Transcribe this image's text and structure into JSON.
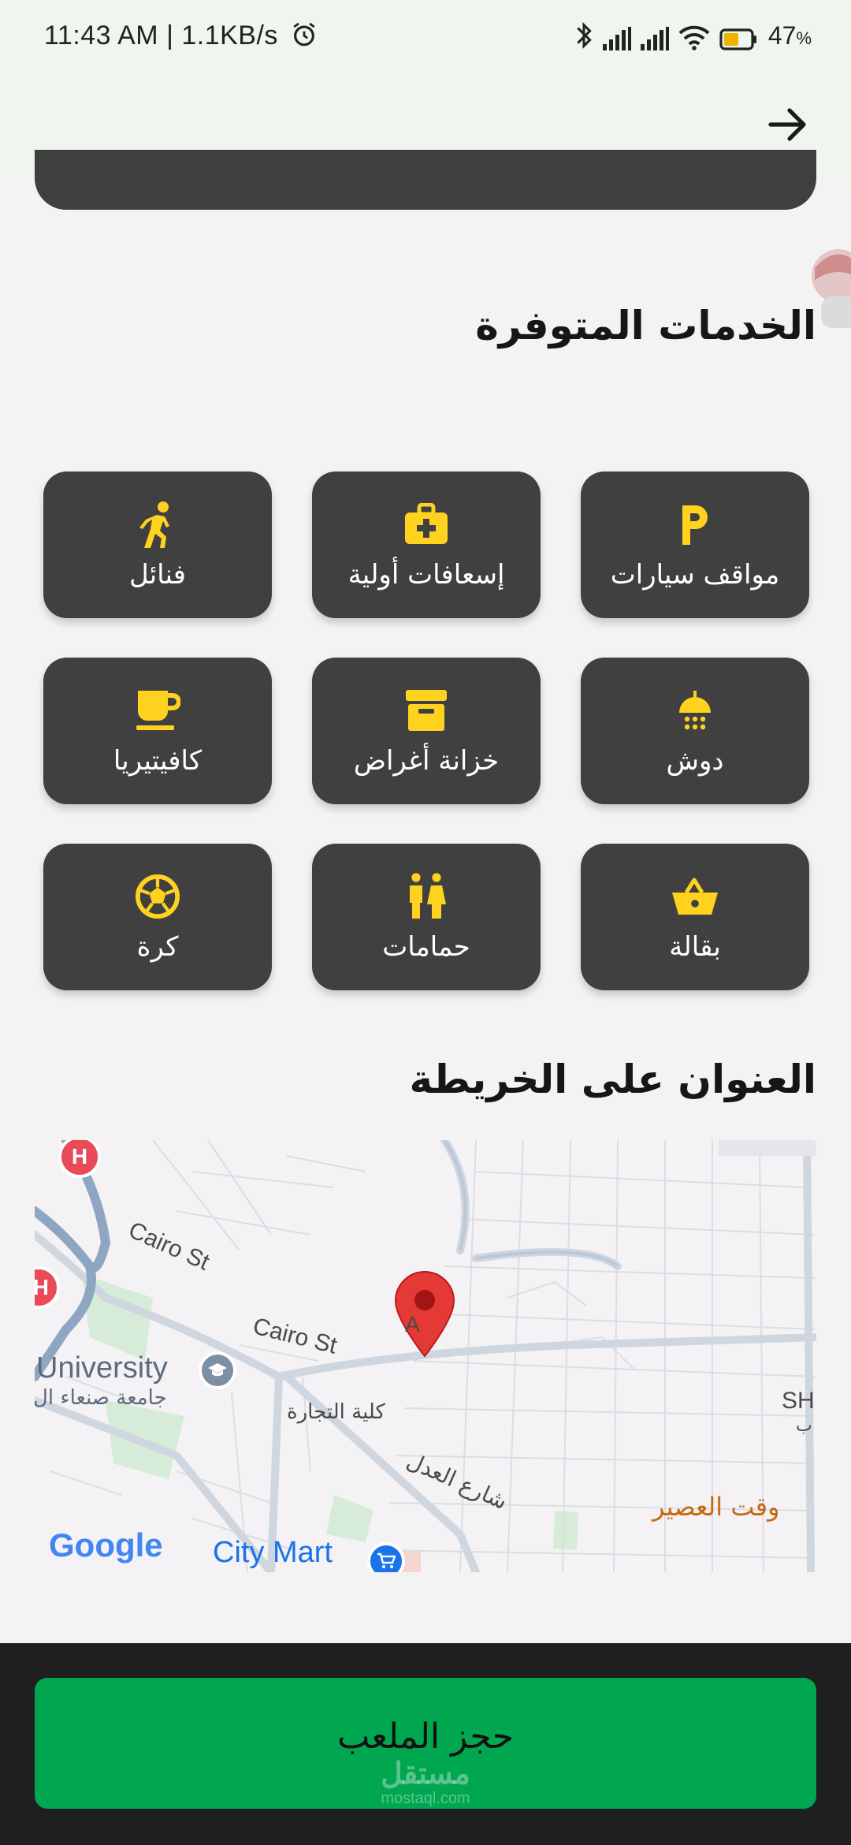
{
  "status_bar": {
    "time": "11:43 AM | 1.1KB/s",
    "battery": "47",
    "battery_unit": "%",
    "icons": [
      "alarm-icon",
      "bluetooth-icon",
      "signal-icon",
      "signal-icon",
      "wifi-icon",
      "battery-icon"
    ]
  },
  "header": {
    "back_icon": "arrow-right-icon"
  },
  "services": {
    "title": "الخدمات المتوفرة",
    "items": [
      {
        "label": "مواقف سيارات",
        "icon": "parking-icon"
      },
      {
        "label": "إسعافات أولية",
        "icon": "first-aid-icon"
      },
      {
        "label": "فنائل",
        "icon": "jersey-icon"
      },
      {
        "label": "دوش",
        "icon": "shower-icon"
      },
      {
        "label": "خزانة أغراض",
        "icon": "locker-icon"
      },
      {
        "label": "كافيتيريا",
        "icon": "coffee-icon"
      },
      {
        "label": "بقالة",
        "icon": "basket-icon"
      },
      {
        "label": "حمامات",
        "icon": "restroom-icon"
      },
      {
        "label": "كرة",
        "icon": "ball-icon"
      }
    ]
  },
  "map": {
    "title": "العنوان على الخريطة",
    "labels": {
      "cairo_st_1": "Cairo St",
      "cairo_st_2": "Cairo St",
      "university_en": "University",
      "university_ar": "جامعة صنعاء ال",
      "commerce_college": "كلية التجارة",
      "adl_street": "شارع العدل",
      "asr_time": "وقت العصير",
      "city_mart": "City Mart",
      "google": "Google",
      "sh": "SH",
      "b": "ب",
      "a": "A"
    },
    "icons": [
      "hospital-icon",
      "hospital-icon",
      "university-icon",
      "location-pin-icon",
      "shopping-cart-icon"
    ]
  },
  "footer": {
    "book_button_label": "حجز الملعب",
    "watermark_main": "مستقل",
    "watermark_sub": "mostaql.com"
  },
  "colors": {
    "accent_yellow": "#FFD21F",
    "card_bg": "#404040",
    "button_green": "#00A650",
    "header_bg": "#EEF6EE",
    "pin_red": "#E53935"
  }
}
